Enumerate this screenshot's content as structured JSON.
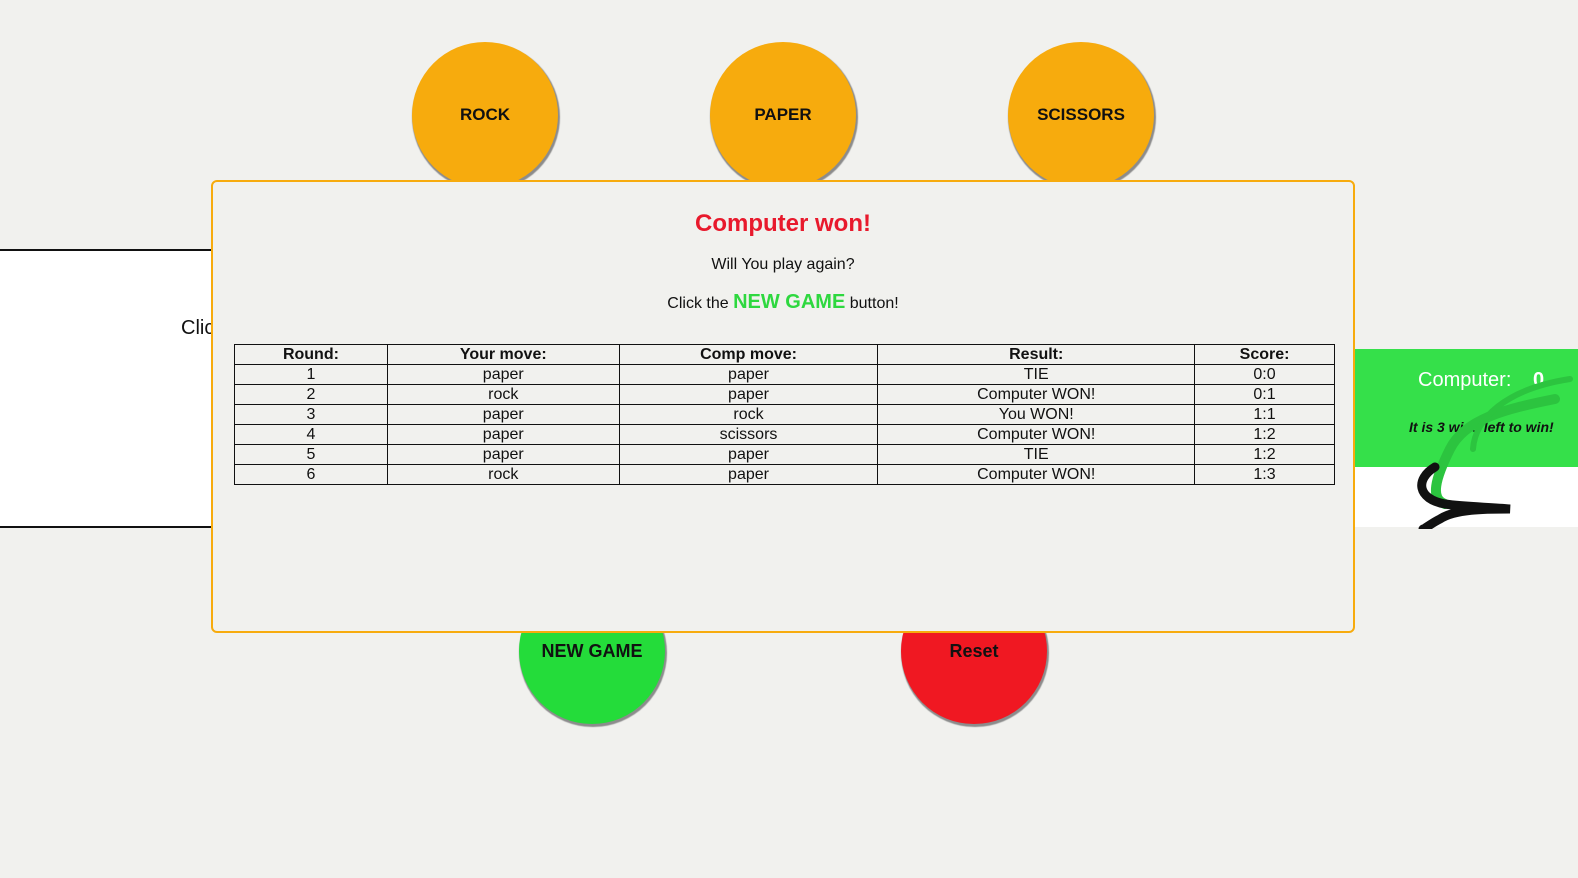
{
  "moves": {
    "rock_label": "ROCK",
    "paper_label": "PAPER",
    "scissors_label": "SCISSORS"
  },
  "left_panel": {
    "text": "Clic"
  },
  "score_panel": {
    "label": "Computer:",
    "value": "0",
    "wins_left": "It is 3 wins left to win!"
  },
  "controls": {
    "new_game_label": "NEW GAME",
    "reset_label": "Reset"
  },
  "modal": {
    "title": "Computer won!",
    "question": "Will You play again?",
    "hint_prefix": "Click the ",
    "hint_highlight": "NEW GAME",
    "hint_suffix": " button!",
    "table": {
      "headers": [
        "Round:",
        "Your move:",
        "Comp move:",
        "Result:",
        "Score:"
      ],
      "rows": [
        [
          "1",
          "paper",
          "paper",
          "TIE",
          "0:0"
        ],
        [
          "2",
          "rock",
          "paper",
          "Computer WON!",
          "0:1"
        ],
        [
          "3",
          "paper",
          "rock",
          "You WON!",
          "1:1"
        ],
        [
          "4",
          "paper",
          "scissors",
          "Computer WON!",
          "1:2"
        ],
        [
          "5",
          "paper",
          "paper",
          "TIE",
          "1:2"
        ],
        [
          "6",
          "rock",
          "paper",
          "Computer WON!",
          "1:3"
        ]
      ]
    }
  },
  "colors": {
    "move_button": "#f7ab0d",
    "new_game": "#24dc3a",
    "reset": "#f01822",
    "title_red": "#e8192c",
    "score_panel": "#35e04a"
  }
}
